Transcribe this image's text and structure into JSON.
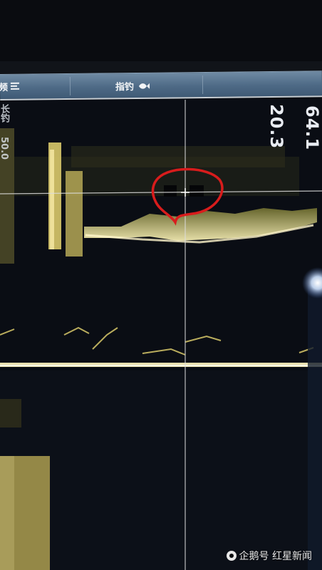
{
  "toolbar": {
    "left_label": "频",
    "center_label": "指钓"
  },
  "readouts": {
    "depth_big": "64.1",
    "depth_small": "20.3",
    "left_label_1": "长钓",
    "left_label_2": "50.0"
  },
  "watermark": {
    "text": "企鹅号 红星新闻"
  },
  "colors": {
    "sonar_echo": "#d9c96a",
    "water": "#0a0d14",
    "crosshair": "#dcdcdc",
    "circle_marker": "#d81c1c",
    "toolbar": "#5a7690"
  }
}
